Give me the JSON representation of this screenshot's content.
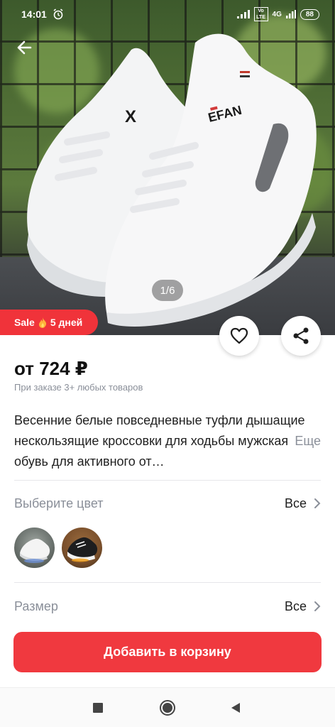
{
  "status_bar": {
    "time": "14:01",
    "network_label": "4G",
    "volte_label": "Vo LTE",
    "battery": "88"
  },
  "gallery": {
    "counter": "1/6",
    "shoe_brand": "EFAN"
  },
  "sale_badge": {
    "label": "Sale",
    "icon": "fire-icon",
    "days": "5 дней"
  },
  "product": {
    "price": "от 724 ₽",
    "price_note": "При заказе 3+ любых товаров",
    "description": "Весенние белые повседневные туфли дышащие нескользящие кроссовки для ходьбы мужская обувь для активного от…",
    "more_label": "Еще"
  },
  "color_selector": {
    "label": "Выберите цвет",
    "value": "Все",
    "options": [
      "white",
      "black"
    ]
  },
  "size_selector": {
    "label": "Размер",
    "value": "Все"
  },
  "cart": {
    "button_label": "Добавить в корзину"
  },
  "colors": {
    "accent": "#f0393f",
    "muted_text": "#8a8f99"
  }
}
